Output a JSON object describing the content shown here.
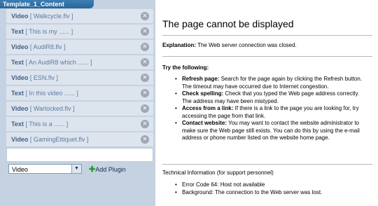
{
  "window": {
    "title": "Template_1_Content"
  },
  "items": [
    {
      "type": "Video",
      "detail": "[ Walkcycle.flv ]"
    },
    {
      "type": "Text",
      "detail": "[ This is my ...... ]"
    },
    {
      "type": "Video",
      "detail": "[ AudiR8.flv ]"
    },
    {
      "type": "Text",
      "detail": "[ An AudiR8 which ...... ]"
    },
    {
      "type": "Video",
      "detail": "[ ESN.flv ]"
    },
    {
      "type": "Text",
      "detail": "[ In this video ...... ]"
    },
    {
      "type": "Video",
      "detail": "[ Warlocked.flv ]"
    },
    {
      "type": "Text",
      "detail": "[ This is a ...... ]"
    },
    {
      "type": "Video",
      "detail": "[ GamingEttiquet.flv ]"
    }
  ],
  "controls": {
    "selected_type": "Video",
    "add_label": "Add Plugin"
  },
  "error_page": {
    "title": "The page cannot be displayed",
    "explanation_label": "Explanation:",
    "explanation_text": " The Web server connection was closed.",
    "try_heading": "Try the following:",
    "tips": [
      {
        "label": "Refresh page:",
        "text": " Search for the page again by clicking the Refresh button. The timeout may have occurred due to Internet congestion."
      },
      {
        "label": "Check spelling:",
        "text": " Check that you typed the Web page address correctly. The address may have been mistyped."
      },
      {
        "label": "Access from a link:",
        "text": " If there is a link to the page you are looking for, try accessing the page from that link."
      },
      {
        "label": "Contact website:",
        "text": " You may want to contact the website administrator to make sure the Web page still exists. You can do this by using the e-mail address or phone number listed on the website home page."
      }
    ],
    "tech_heading": "Technical Information (for support personnel)",
    "tech_items": [
      "Error Code 64: Host not available",
      "Background: The connection to the Web server was lost."
    ]
  }
}
